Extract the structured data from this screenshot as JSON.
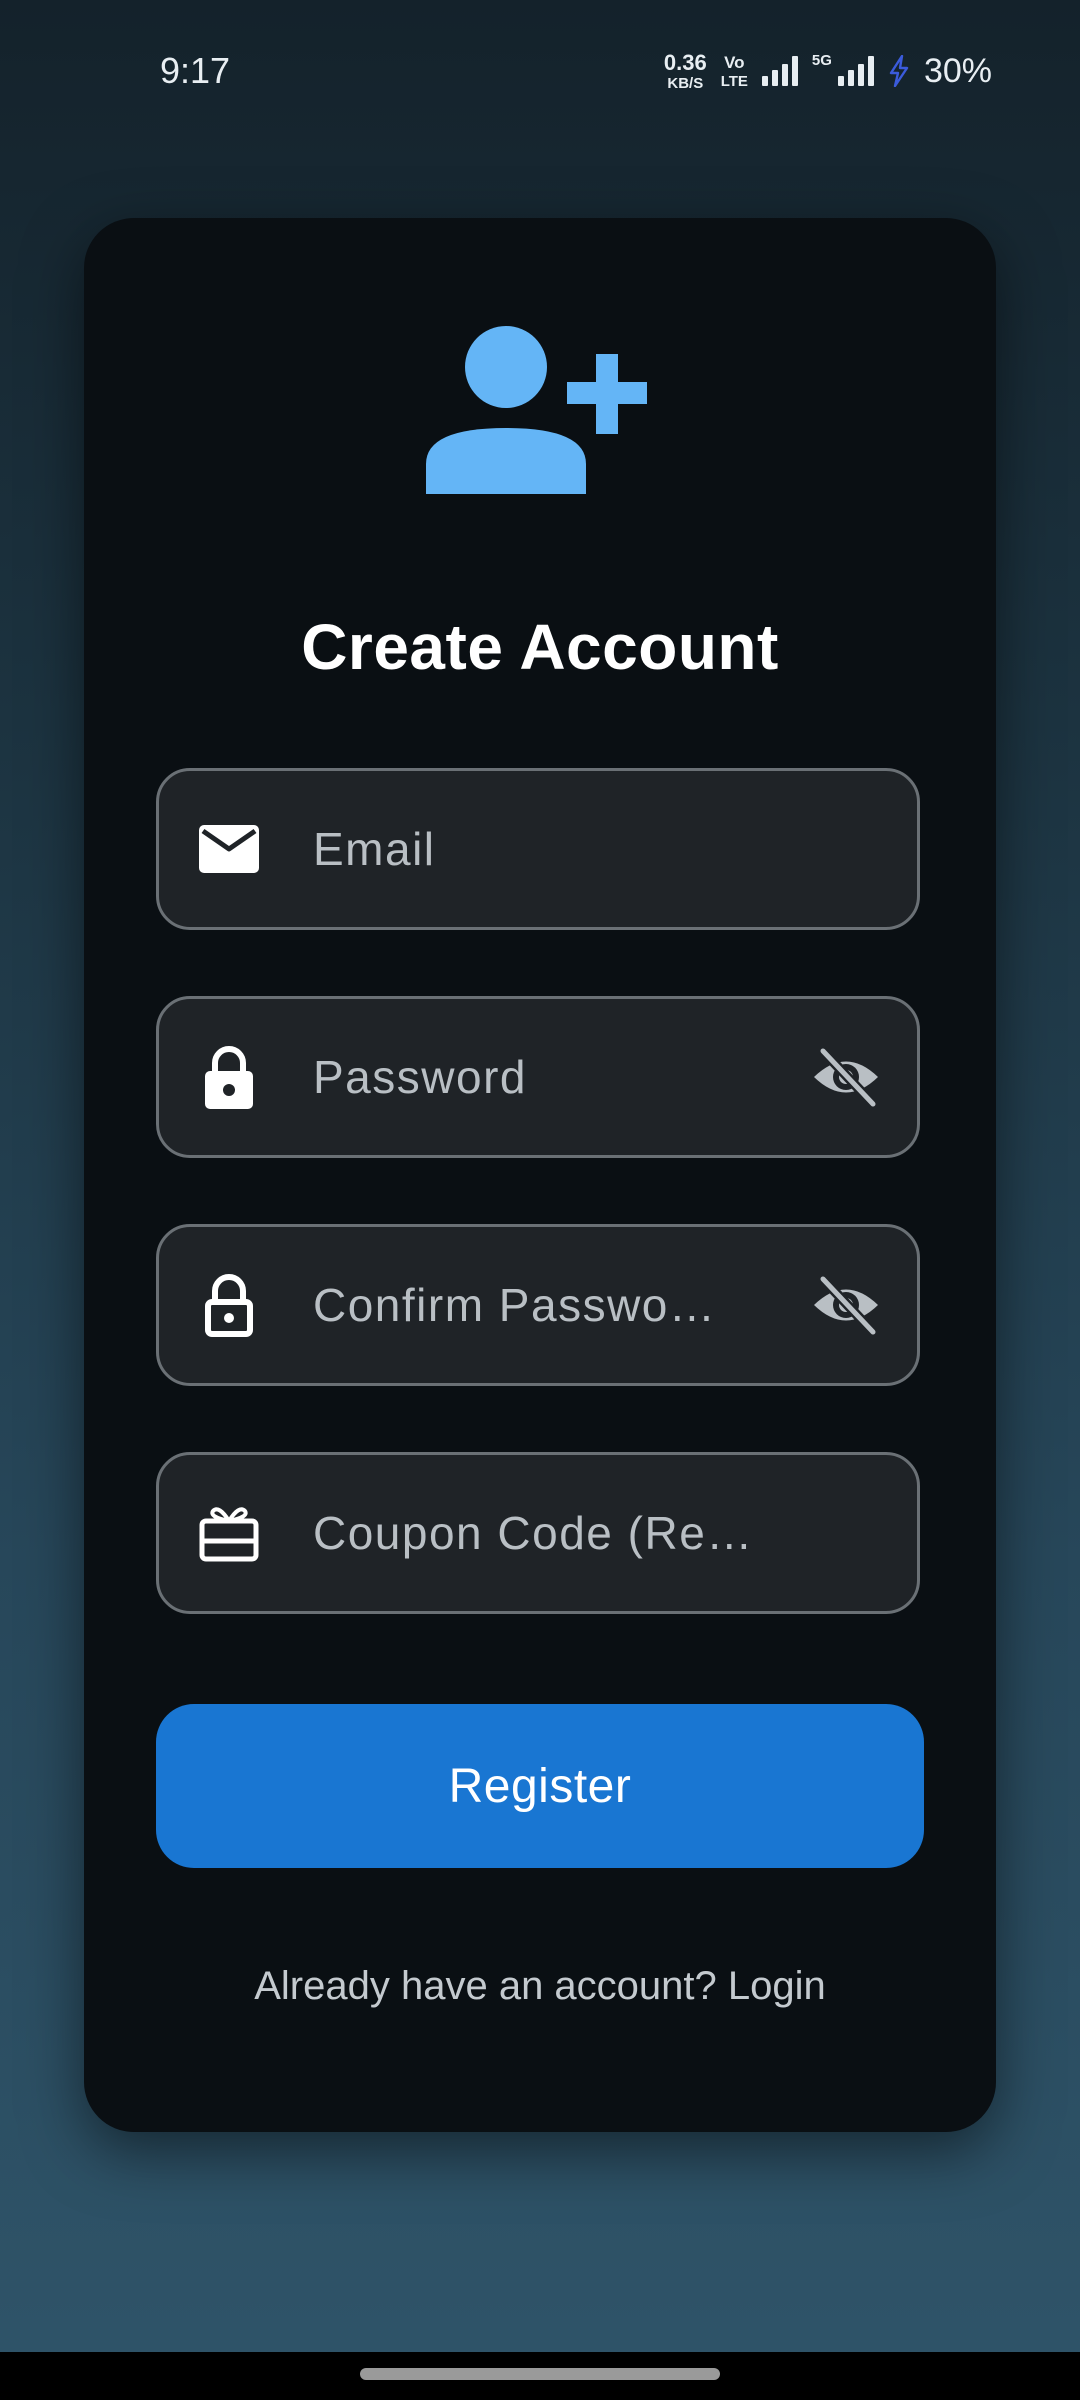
{
  "status_bar": {
    "time": "9:17",
    "net_speed_value": "0.36",
    "net_speed_unit": "KB/S",
    "volte_top": "Vo",
    "volte_bottom": "LTE",
    "network_tag": "5G",
    "battery_percent": "30%",
    "icons": [
      "signal-icon",
      "signal-5g-icon",
      "charging-bolt-icon"
    ]
  },
  "card": {
    "header_icon": "person-add-icon",
    "title": "Create Account",
    "accent_color": "#64b5f6"
  },
  "fields": {
    "email": {
      "placeholder": "Email",
      "icon": "mail-icon"
    },
    "password": {
      "placeholder": "Password",
      "icon": "lock-icon",
      "toggle_icon": "visibility-off-icon"
    },
    "confirm_password": {
      "placeholder": "Confirm Passwo…",
      "icon": "lock-outline-icon",
      "toggle_icon": "visibility-off-icon"
    },
    "coupon": {
      "placeholder": "Coupon Code (Require…",
      "icon": "card-giftcard-icon"
    }
  },
  "actions": {
    "register_label": "Register",
    "register_color": "#1976d2",
    "login_prompt": "Already have an account? Login"
  }
}
